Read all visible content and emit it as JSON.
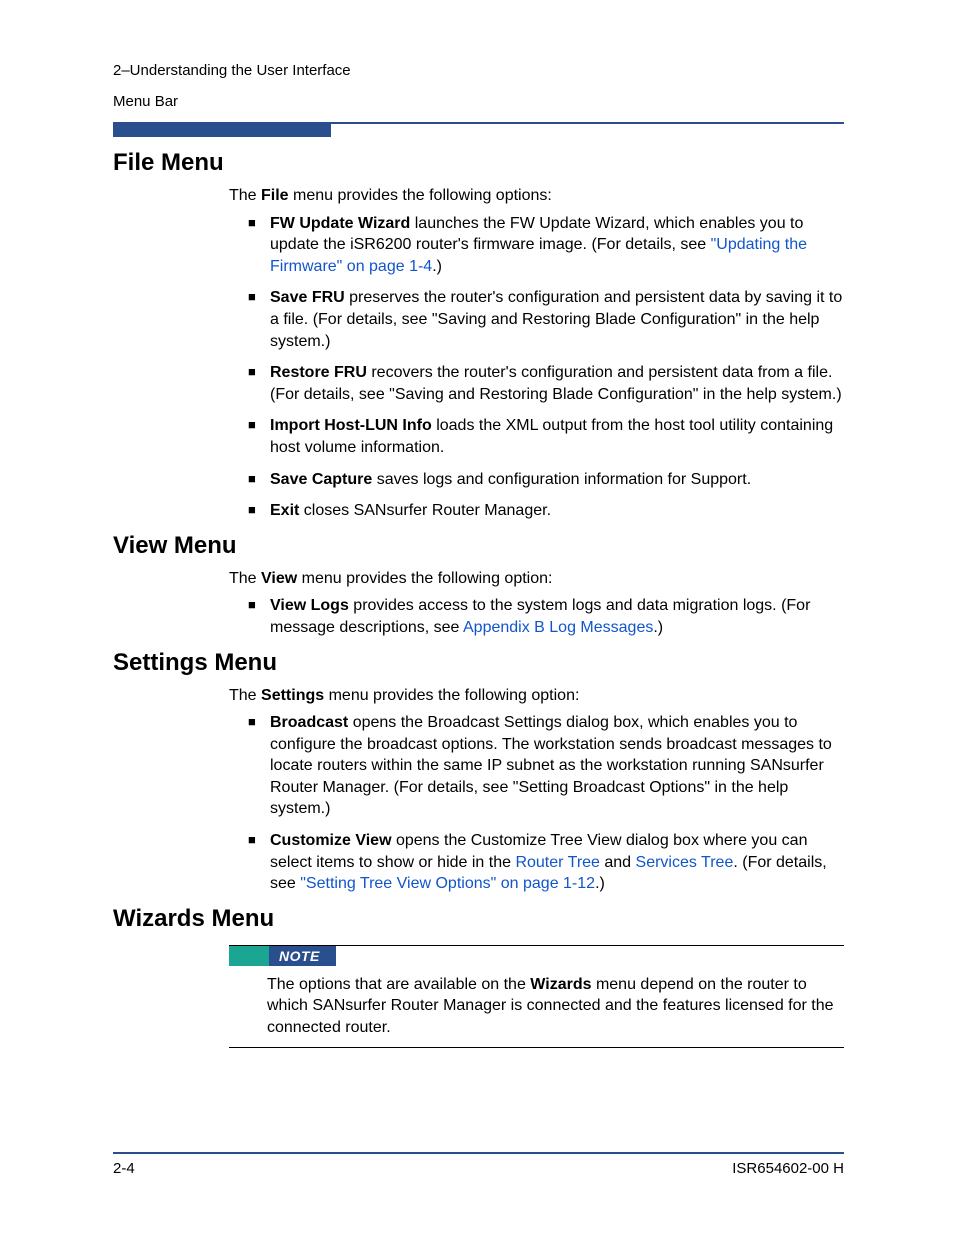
{
  "header": {
    "chapter_line": "2–Understanding the User Interface",
    "section_line": "Menu Bar"
  },
  "sections": {
    "file": {
      "heading": "File Menu",
      "intro_pre": "The ",
      "intro_bold": "File",
      "intro_post": " menu provides the following options:",
      "items": {
        "fw_update": {
          "bold": "FW Update Wizard",
          "text1": " launches the FW Update Wizard, which enables you to update the iSR6200 router's firmware image. (For details, see ",
          "link": "\"Updating the Firmware\" on page 1-4",
          "text2": ".)"
        },
        "save_fru": {
          "bold": "Save FRU",
          "text": " preserves the router's configuration and persistent data by saving it to a file. (For details, see \"Saving and Restoring Blade Configuration\" in the help system.)"
        },
        "restore_fru": {
          "bold": "Restore FRU",
          "text": " recovers the router's configuration and persistent data from a file. (For details, see \"Saving and Restoring Blade Configuration\" in the help system.)"
        },
        "import": {
          "bold": "Import Host-LUN Info",
          "text": " loads the XML output from the host tool utility containing host volume information."
        },
        "save_capture": {
          "bold": "Save Capture",
          "text": " saves logs and configuration information for Support."
        },
        "exit": {
          "bold": "Exit",
          "text": " closes SANsurfer Router Manager."
        }
      }
    },
    "view": {
      "heading": "View Menu",
      "intro_pre": "The ",
      "intro_bold": "View",
      "intro_post": " menu provides the following option:",
      "items": {
        "view_logs": {
          "bold": "View Logs",
          "text1": " provides access to the system logs and data migration logs. (For message descriptions, see ",
          "link": "Appendix B Log Messages",
          "text2": ".)"
        }
      }
    },
    "settings": {
      "heading": "Settings Menu",
      "intro_pre": "The ",
      "intro_bold": "Settings",
      "intro_post": " menu provides the following option:",
      "items": {
        "broadcast": {
          "bold": "Broadcast",
          "text": " opens the Broadcast Settings dialog box, which enables you to configure the broadcast options. The workstation sends broadcast messages to locate routers within the same IP subnet as the workstation running SANsurfer Router Manager. (For details, see \"Setting Broadcast Options\" in the help system.)"
        },
        "customize": {
          "bold": "Customize View",
          "text1": " opens the Customize Tree View dialog box where you can select items to show or hide in the ",
          "link1": "Router Tree",
          "text2": " and ",
          "link2": "Services Tree",
          "text3": ". (For details, see ",
          "link3": "\"Setting Tree View Options\" on page 1-12",
          "text4": ".)"
        }
      }
    },
    "wizards": {
      "heading": "Wizards Menu",
      "note_label": "NOTE",
      "note_text_pre": "The options that are available on the ",
      "note_text_bold": "Wizards",
      "note_text_post": " menu depend on the router to which SANsurfer Router Manager is connected and the features licensed for the connected router."
    }
  },
  "footer": {
    "page": "2-4",
    "doc_id": "ISR654602-00  H"
  }
}
